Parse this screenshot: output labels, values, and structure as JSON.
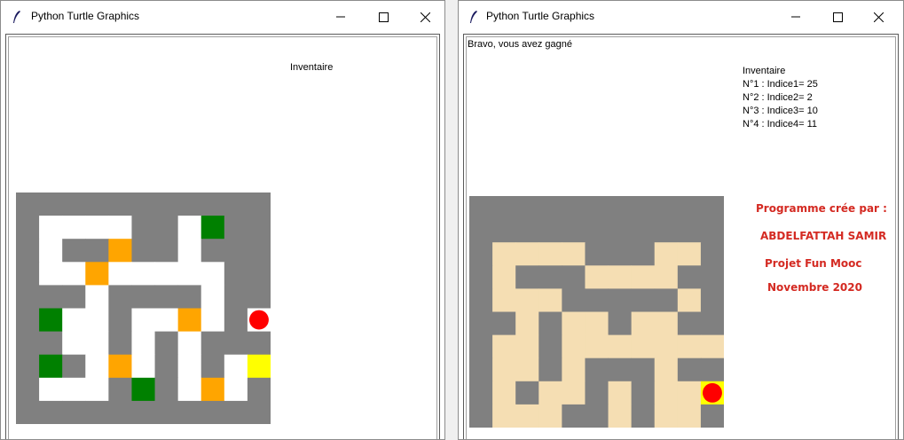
{
  "windows": [
    {
      "title": "Python Turtle Graphics",
      "inventory_title": "Inventaire",
      "message": "",
      "inventory_items": [],
      "credits": [],
      "maze": {
        "cols": 11,
        "rows": 10,
        "grid": [
          "GGGGGGGGGGG",
          "GWWWWGGWNGG",
          "GWGGOGGWGGG",
          "GWWOWWWWWGG",
          "GGGWGGGGWGG",
          "GNWWGWWOWGR",
          "GGWWGWGWGGG",
          "GNGWOWGWGWY",
          "GWWWGNGWOWG",
          "GGGGGGGGGGG"
        ],
        "colors": {
          "G": "#808080",
          "W": "#ffffff",
          "O": "#ffa500",
          "N": "#008000",
          "Y": "#ffff00",
          "R": "#ffffff"
        },
        "player": {
          "row": 5,
          "col": 10,
          "color": "#ff0000"
        }
      }
    },
    {
      "title": "Python Turtle Graphics",
      "message": "Bravo, vous avez gagné",
      "inventory_title": "Inventaire",
      "inventory_items": [
        "N°1 : Indice1= 25",
        "N°2 : Indice2= 2",
        "N°3 : Indice3= 10",
        "N°4 : Indice4= 11"
      ],
      "credits": [
        "Programme crée par :",
        "ABDELFATTAH SAMIR",
        "Projet Fun Mooc",
        "Novembre 2020"
      ],
      "credit_color": "#d42a22",
      "maze": {
        "cols": 11,
        "rows": 10,
        "grid": [
          "GGGGGGGGGGG",
          "GGGGGGGGGGG",
          "GBBBBGGGBBG",
          "GBGGGBBBBGG",
          "GBBBGGGGGBG",
          "GGBGBBGBBGG",
          "GBBGBBBBBBB",
          "GBBGBGGGBGG",
          "GBGBBGBGBBY",
          "GBBBGGBGBBG"
        ],
        "colors": {
          "G": "#808080",
          "B": "#f5deb3",
          "Y": "#ffff00"
        },
        "player": {
          "row": 8,
          "col": 10,
          "color": "#ff0000"
        }
      }
    }
  ]
}
